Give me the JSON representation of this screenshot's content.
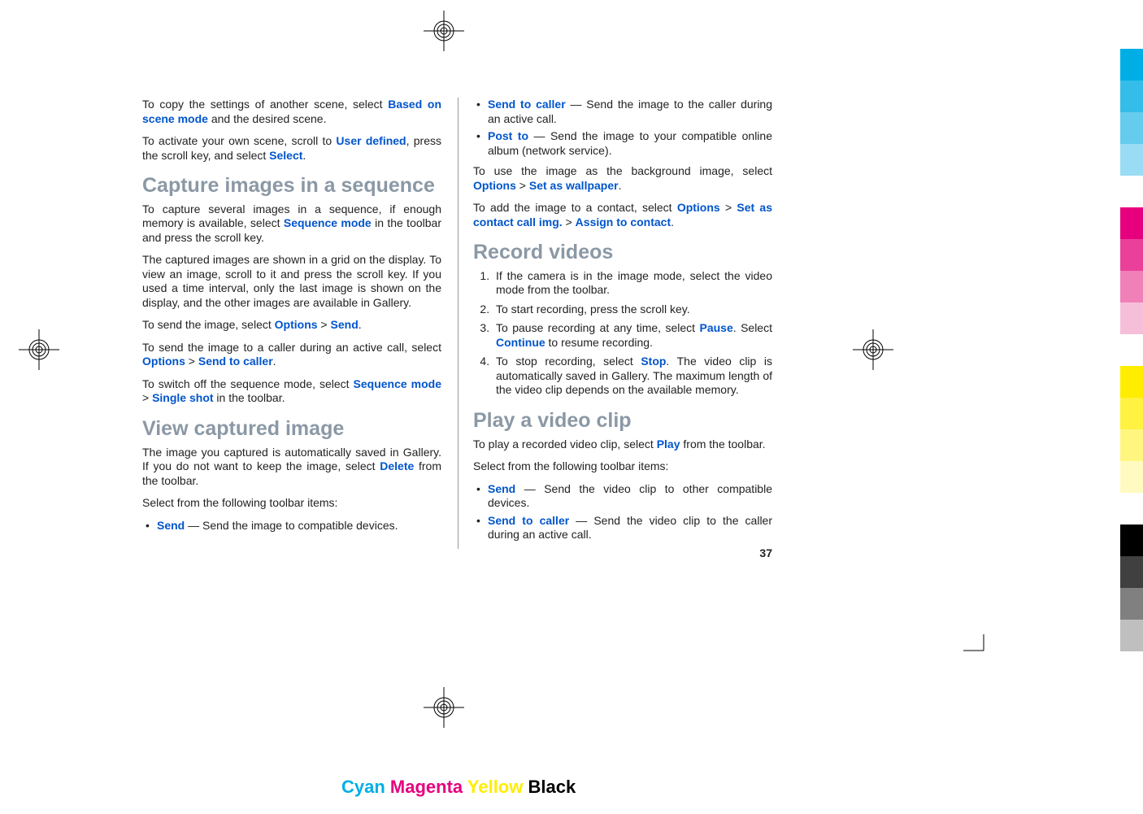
{
  "col1": {
    "p1a": "To copy the settings of another scene, select ",
    "p1b": "Based on scene mode",
    "p1c": " and the desired scene.",
    "p2a": "To activate your own scene, scroll to ",
    "p2b": "User defined",
    "p2c": ", press the scroll key, and select ",
    "p2d": "Select",
    "p2e": ".",
    "h1": "Capture images in a sequence",
    "p3a": "To capture several images in a sequence, if enough memory is available, select ",
    "p3b": "Sequence mode",
    "p3c": " in the toolbar and press the scroll key.",
    "p4": "The captured images are shown in a grid on the display. To view an image, scroll to it and press the scroll key. If you used a time interval, only the last image is shown on the display, and the other images are available in Gallery.",
    "p5a": "To send the image, select ",
    "p5b": "Options",
    "p5c": " > ",
    "p5d": "Send",
    "p5e": ".",
    "p6a": "To send the image to a caller during an active call, select ",
    "p6b": "Options",
    "p6c": " > ",
    "p6d": "Send to caller",
    "p6e": ".",
    "p7a": "To switch off the sequence mode, select ",
    "p7b": "Sequence mode",
    "p7c": " > ",
    "p7d": "Single shot",
    "p7e": " in the toolbar.",
    "h2": "View captured image",
    "p8a": "The image you captured is automatically saved in Gallery. If you do not want to keep the image, select ",
    "p8b": "Delete",
    "p8c": " from the toolbar.",
    "p9": "Select from the following toolbar items:",
    "li1a": "Send",
    "li1b": "  — Send the image to compatible devices."
  },
  "col2": {
    "li2a": "Send to caller",
    "li2b": "  — Send the image to the caller during an active call.",
    "li3a": "Post to",
    "li3b": "  — Send the image to your compatible online album (network service).",
    "p10a": "To use the image as the background image, select ",
    "p10b": "Options",
    "p10c": " > ",
    "p10d": "Set as wallpaper",
    "p10e": ".",
    "p11a": "To add the image to a contact, select ",
    "p11b": "Options",
    "p11c": " > ",
    "p11d": "Set as contact call img.",
    "p11e": " > ",
    "p11f": "Assign to contact",
    "p11g": ".",
    "h3": "Record videos",
    "ol1": "If the camera is in the image mode, select the video mode from the toolbar.",
    "ol2": "To start recording, press the scroll key.",
    "ol3a": "To pause recording at any time, select ",
    "ol3b": "Pause",
    "ol3c": ". Select ",
    "ol3d": "Continue",
    "ol3e": " to resume recording.",
    "ol4a": "To stop recording, select ",
    "ol4b": "Stop",
    "ol4c": ". The video clip is automatically saved in Gallery. The maximum length of the video clip depends on the available memory.",
    "h4": "Play a video clip",
    "p12a": "To play a recorded video clip, select ",
    "p12b": "Play",
    "p12c": " from the toolbar.",
    "p13": "Select from the following toolbar items:",
    "li4a": "Send",
    "li4b": "  — Send the video clip to other compatible devices.",
    "li5a": "Send to caller",
    "li5b": "  — Send the video clip to the caller during an active call."
  },
  "pageNumber": "37",
  "footer": {
    "cyan": "Cyan",
    "magenta": "Magenta",
    "yellow": "Yellow",
    "black": "Black"
  },
  "colorBars": [
    "#00aee6",
    "#33bde8",
    "#66ccee",
    "#99dcf3",
    "#ffffff",
    "#e6007e",
    "#eb4099",
    "#f080b8",
    "#f6bfd9",
    "#ffffff",
    "#ffed00",
    "#fff240",
    "#fff680",
    "#fffbc0",
    "#ffffff",
    "#000000",
    "#404040",
    "#808080",
    "#bfbfbf"
  ]
}
